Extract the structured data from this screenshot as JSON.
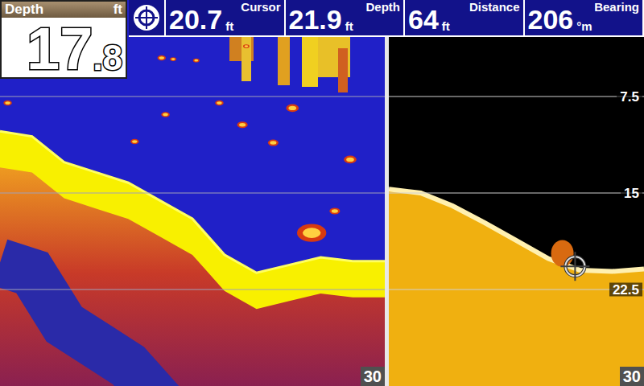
{
  "depth_box": {
    "label": "Depth",
    "unit": "ft",
    "value_whole": "17",
    "value_decimal": ".8"
  },
  "readouts": [
    {
      "value": "20.7",
      "unit": "ft",
      "label": "Cursor"
    },
    {
      "value": "21.9",
      "unit": "ft",
      "label": "Depth"
    },
    {
      "value": "64",
      "unit": "ft",
      "label": "Distance"
    },
    {
      "value": "206",
      "unit": "°m",
      "label": "Bearing"
    }
  ],
  "scale": [
    "7.5",
    "15",
    "22.5"
  ],
  "left_panel": {
    "range_label": "30",
    "bottom_depths": [
      10.2,
      10.6,
      12.6,
      13.4,
      14.2,
      15.6,
      17.0,
      19.8,
      21.2,
      20.6,
      20.0,
      20.3,
      20.3
    ],
    "fish": [
      {
        "ping": 0.02,
        "depth": 8.0,
        "size": 4
      },
      {
        "ping": 0.42,
        "depth": 4.5,
        "size": 4
      },
      {
        "ping": 0.45,
        "depth": 4.6,
        "size": 3
      },
      {
        "ping": 0.51,
        "depth": 4.7,
        "size": 3
      },
      {
        "ping": 0.64,
        "depth": 3.6,
        "size": 3
      },
      {
        "ping": 0.57,
        "depth": 8.0,
        "size": 4
      },
      {
        "ping": 0.63,
        "depth": 9.7,
        "size": 5
      },
      {
        "ping": 0.76,
        "depth": 8.4,
        "size": 6
      },
      {
        "ping": 0.43,
        "depth": 8.9,
        "size": 4
      },
      {
        "ping": 0.35,
        "depth": 11.0,
        "size": 4
      },
      {
        "ping": 0.71,
        "depth": 11.1,
        "size": 5
      },
      {
        "ping": 0.91,
        "depth": 12.4,
        "size": 6
      },
      {
        "ping": 0.87,
        "depth": 16.4,
        "size": 5
      },
      {
        "ping": 0.81,
        "depth": 18.1,
        "size": 14
      }
    ]
  },
  "right_panel": {
    "range_label": "30",
    "bottom_depths": [
      14.7,
      15.0,
      16.0,
      17.3,
      18.7,
      20.1,
      21.0,
      21.1,
      20.9
    ],
    "targets": [
      {
        "ping": 0.68,
        "depth": 19.7,
        "size": 14
      }
    ],
    "cursor": {
      "ping": 0.73,
      "depth": 20.7
    }
  }
}
